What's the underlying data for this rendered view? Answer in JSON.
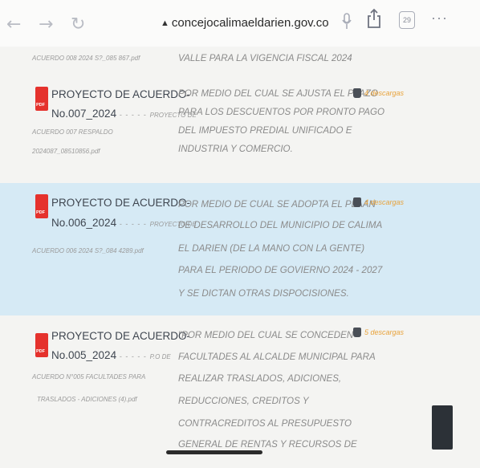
{
  "browser": {
    "back_glyph": "←",
    "forward_glyph": "→",
    "reload_glyph": "↻",
    "url": "concejocalimaeldarien.gov.co",
    "tab_count": "29",
    "more_glyph": "···",
    "icons": [
      "back-arrow-icon",
      "forward-arrow-icon",
      "reload-icon",
      "lock-icon",
      "microphone-icon",
      "share-icon",
      "tabs-icon",
      "more-icon"
    ]
  },
  "top_partial": {
    "file": "ACUERDO 008 2024 S?_085 867.pdf",
    "desc": "VALLE PARA LA VIGENCIA FISCAL 2024"
  },
  "rows": [
    {
      "title": "PROYECTO DE ACUERDO-",
      "number": "No.007_2024",
      "dashes": "- - - - -",
      "file_rest": "PROYECTO DE",
      "file_lines": [
        "ACUERDO 007 RESPALDO",
        "2024087_08510856.pdf"
      ],
      "desc": [
        "POR MEDIO DEL CUAL SE AJUSTA EL PLAZO",
        "PARA LOS DESCUENTOS POR PRONTO PAGO",
        "DEL IMPUESTO PREDIAL UNIFICADO E",
        "INDUSTRIA Y COMERCIO."
      ],
      "downloads": "4 descargas"
    },
    {
      "title": "PROYECTO DE ACUERDO-",
      "number": "No.006_2024",
      "dashes": "- - - - -",
      "file_rest": "PROYECTO DE",
      "file_lines": [
        "ACUERDO 006 2024 S?_084 4289.pdf"
      ],
      "desc": [
        "POR MEDIO DE CUAL SE ADOPTA  EL PLAAN",
        "DE DESARROLLO DEL MUNICIPIO DE CALIMA",
        "EL DARIEN (DE LA MANO CON LA GENTE)",
        "PARA EL PERIODO DE GOVIERNO 2024 - 2027",
        "Y SE DICTAN OTRAS DISPOCISIONES."
      ],
      "downloads": "4 descargas"
    },
    {
      "title": "PROYECTO DE ACUERDO-",
      "number": "No.005_2024",
      "dashes": "- - - - -",
      "file_rest": "P.O DE",
      "file_lines": [
        "ACUERDO N°005 FACULTADES PARA",
        "TRASLADOS - ADICIONES (4).pdf"
      ],
      "desc": [
        "\"POR MEDIO DEL CUAL SE CONCEDEN",
        "FACULTADES AL ALCALDE MUNICIPAL PARA",
        "REALIZAR TRASLADOS, ADICIONES,",
        "REDUCCIONES, CREDITOS Y",
        "CONTRACREDITOS AL PRESUPUESTO",
        "GENERAL DE RENTAS Y RECURSOS DE"
      ],
      "downloads": "5 descargas"
    }
  ]
}
